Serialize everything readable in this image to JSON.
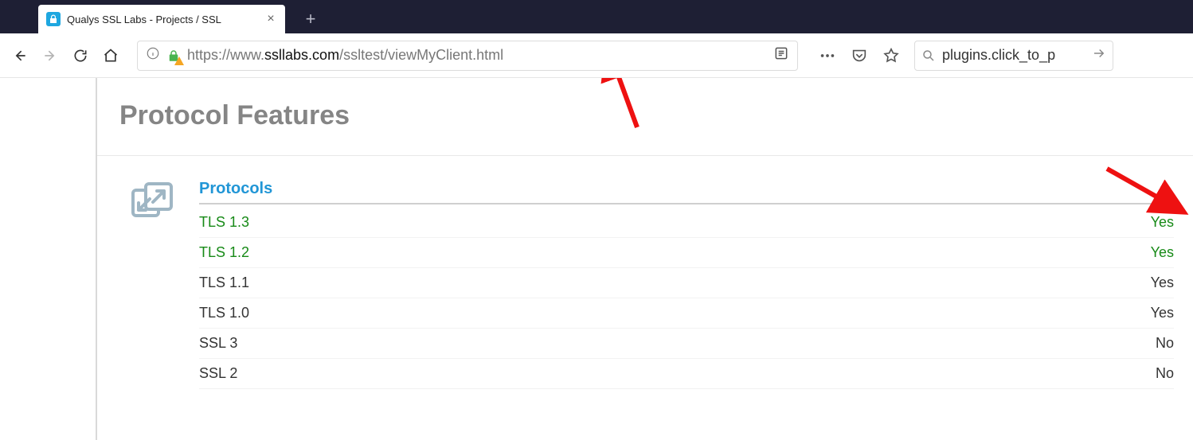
{
  "browser": {
    "tab_title": "Qualys SSL Labs - Projects / SSL",
    "url_scheme": "https://www.",
    "url_domain": "ssllabs.com",
    "url_path": "/ssltest/viewMyClient.html",
    "search_value": "plugins.click_to_p"
  },
  "page": {
    "heading": "Protocol Features",
    "section_title": "Protocols",
    "protocols": [
      {
        "name": "TLS 1.3",
        "value": "Yes",
        "green": true
      },
      {
        "name": "TLS 1.2",
        "value": "Yes",
        "green": true
      },
      {
        "name": "TLS 1.1",
        "value": "Yes",
        "green": false
      },
      {
        "name": "TLS 1.0",
        "value": "Yes",
        "green": false
      },
      {
        "name": "SSL 3",
        "value": "No",
        "green": false
      },
      {
        "name": "SSL 2",
        "value": "No",
        "green": false
      }
    ]
  }
}
